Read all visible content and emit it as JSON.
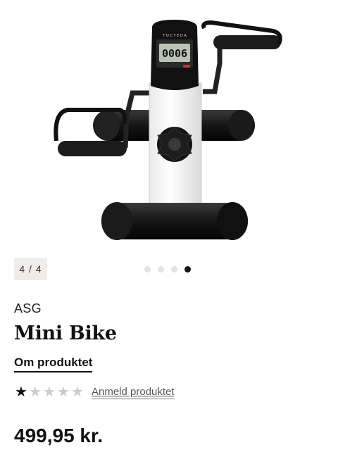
{
  "gallery": {
    "counter": "4 / 4",
    "slides_total": 4,
    "active_slide": 4,
    "display_reading": "0006",
    "display_brand": "T O C T E D A"
  },
  "product": {
    "brand": "ASG",
    "name": "Mini Bike",
    "about_link": "Om produktet",
    "rating": {
      "value": 1,
      "max": 5
    },
    "review_link": "Anmeld produktet",
    "price": "499,95 kr."
  }
}
